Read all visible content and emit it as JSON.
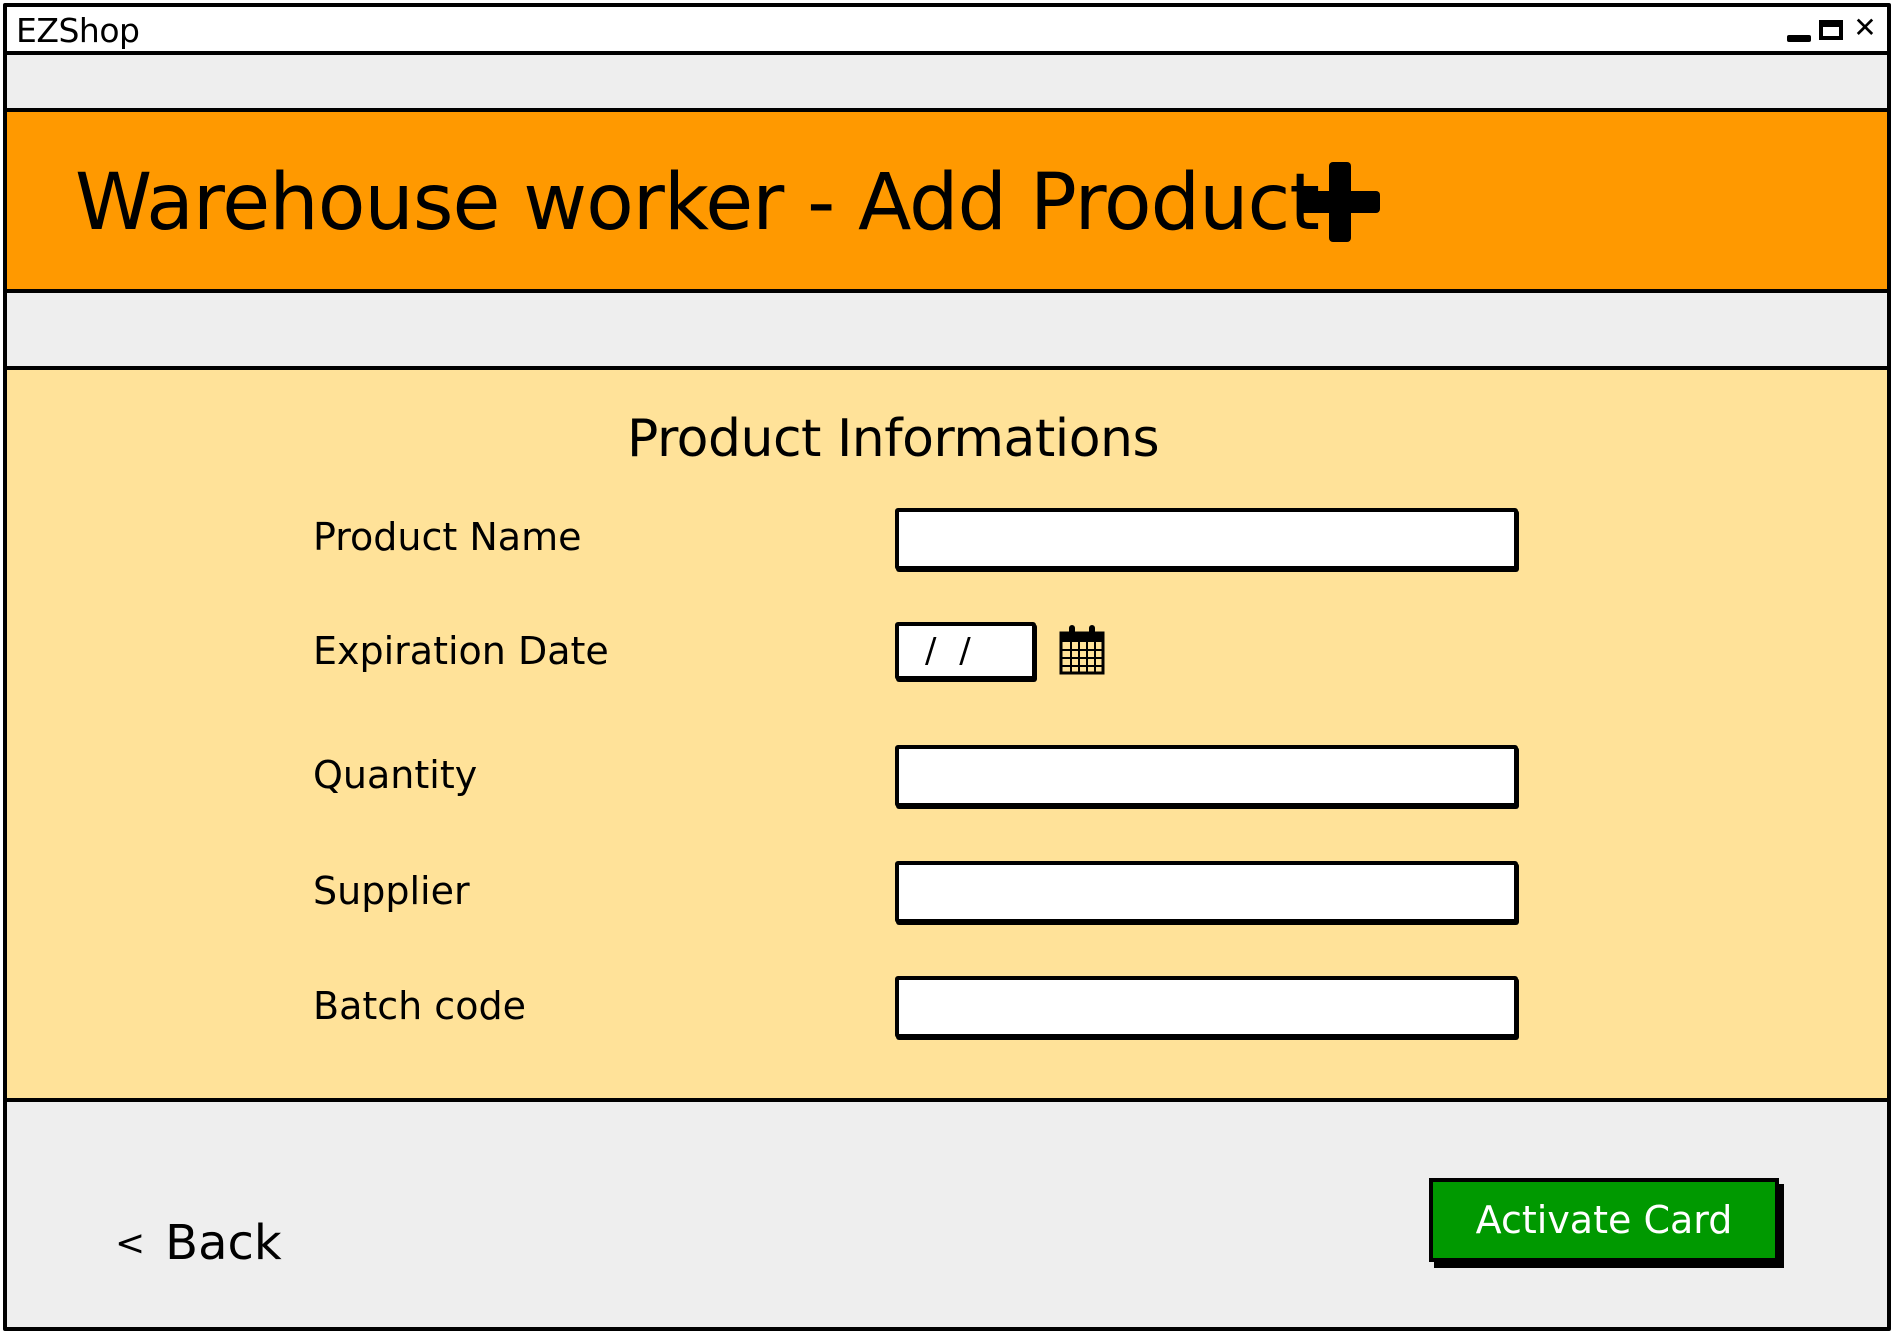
{
  "window": {
    "app_title": "EZShop",
    "controls": [
      "minimize",
      "maximize",
      "close"
    ]
  },
  "header": {
    "title": "Warehouse worker - Add Product",
    "icon": "plus-icon",
    "background_color": "#ff9900"
  },
  "form": {
    "section_title": "Product Informations",
    "background_color": "#ffe299",
    "fields": {
      "product_name": {
        "label": "Product Name",
        "value": ""
      },
      "expiration_date": {
        "label": "Expiration Date",
        "value": "/ /",
        "icon": "calendar-icon"
      },
      "quantity": {
        "label": "Quantity",
        "value": ""
      },
      "supplier": {
        "label": "Supplier",
        "value": ""
      },
      "batch_code": {
        "label": "Batch code",
        "value": ""
      }
    }
  },
  "footer": {
    "back_chevron": "<",
    "back_label": "Back",
    "activate_label": "Activate Card",
    "activate_color": "#009900"
  }
}
